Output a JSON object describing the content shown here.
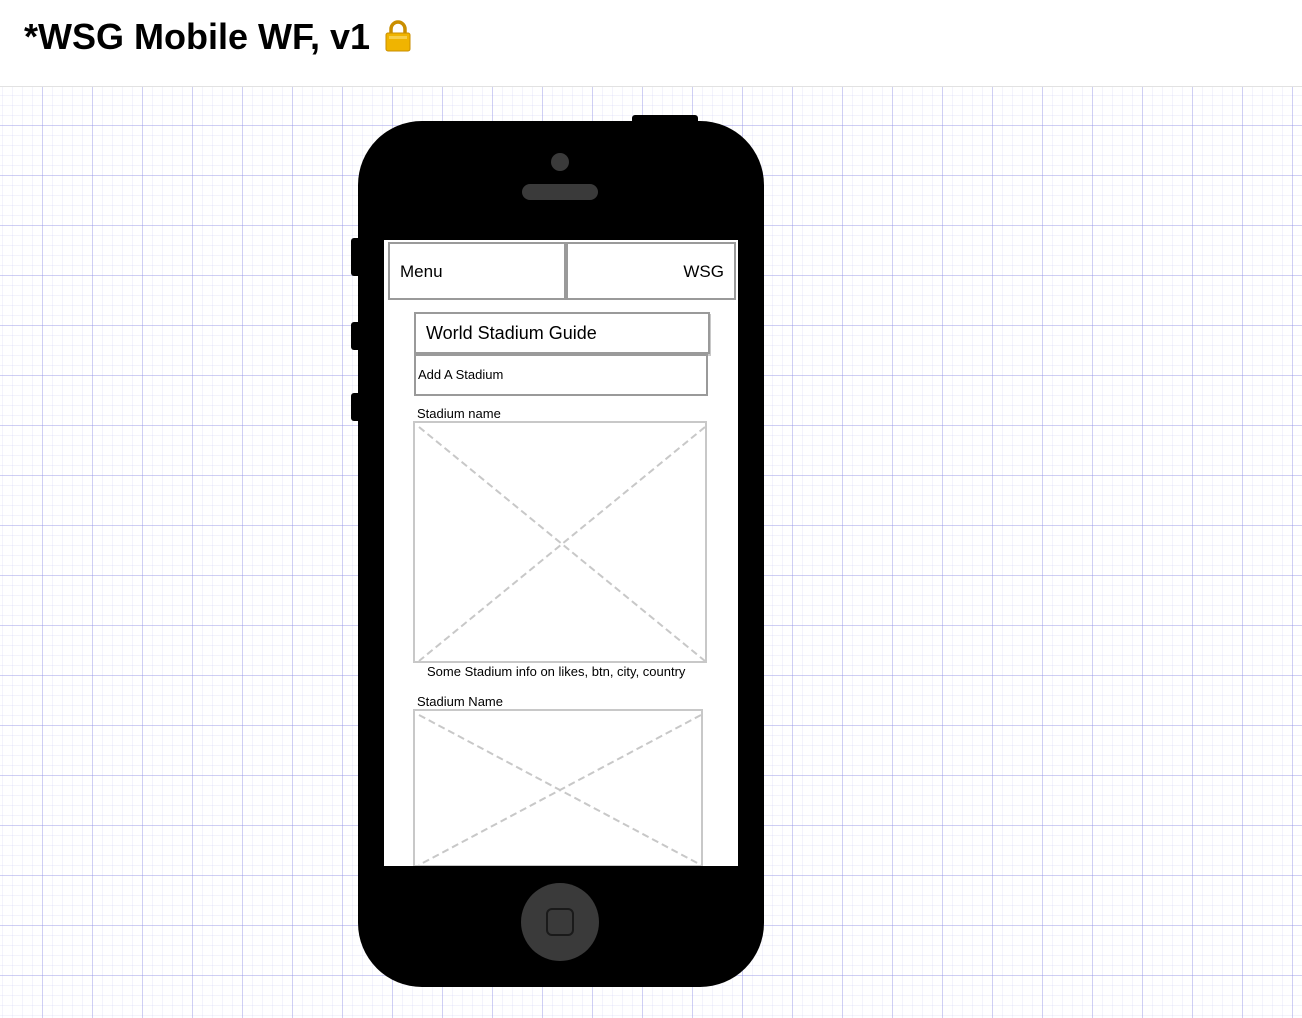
{
  "document": {
    "title": "*WSG Mobile WF, v1",
    "lock_icon": "lock-icon",
    "lock_color": "#f0b400"
  },
  "canvas": {
    "grid_color": "#c8c8f0",
    "device": "iphone-5"
  },
  "mockup": {
    "nav": {
      "menu_label": "Menu",
      "brand_label": "WSG"
    },
    "site_title": "World Stadium Guide",
    "add_stadium_label": "Add A Stadium",
    "stadiums": [
      {
        "name_label": "Stadium name",
        "info": "Some Stadium info on likes, btn, city, country"
      },
      {
        "name_label": "Stadium Name"
      }
    ]
  }
}
